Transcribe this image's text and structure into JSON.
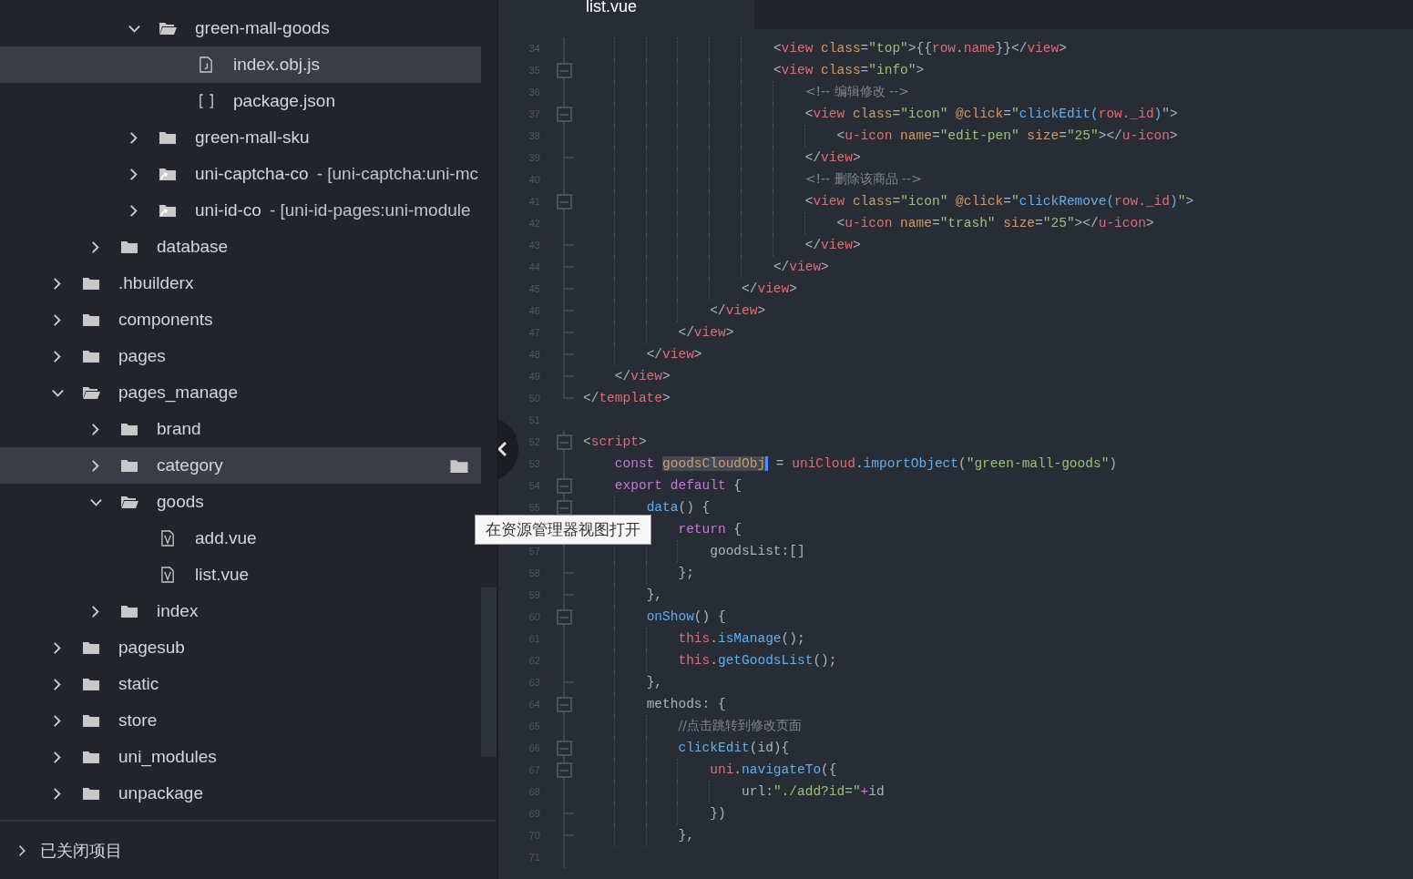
{
  "sidebar": {
    "tree": [
      {
        "children": [
          {
            "children": [
              {
                "label": "green-mall-goods",
                "kind": "folder",
                "expanded": true,
                "selected": false,
                "hovered": false,
                "children": [
                  {
                    "label": "index.obj.js",
                    "kind": "js",
                    "selected": true,
                    "hovered": false
                  },
                  {
                    "label": "package.json",
                    "kind": "json",
                    "selected": false,
                    "hovered": false
                  }
                ]
              },
              {
                "label": "green-mall-sku",
                "kind": "folder",
                "expanded": false,
                "selected": false,
                "hovered": false
              },
              {
                "label": "uni-captcha-co",
                "suffix": "- [uni-captcha:uni-mc",
                "kind": "linked-folder",
                "expanded": false,
                "selected": false,
                "hovered": false
              },
              {
                "label": "uni-id-co",
                "suffix": "- [uni-id-pages:uni-module",
                "kind": "linked-folder",
                "expanded": false,
                "selected": false,
                "hovered": false
              }
            ]
          },
          {
            "label": "database",
            "kind": "folder",
            "expanded": false,
            "selected": false,
            "hovered": false
          }
        ]
      },
      {
        "label": ".hbuilderx",
        "kind": "folder",
        "expanded": false,
        "selected": false,
        "hovered": false
      },
      {
        "label": "components",
        "kind": "folder",
        "expanded": false,
        "selected": false,
        "hovered": false
      },
      {
        "label": "pages",
        "kind": "folder",
        "expanded": false,
        "selected": false,
        "hovered": false
      },
      {
        "label": "pages_manage",
        "kind": "folder",
        "expanded": true,
        "selected": false,
        "hovered": false,
        "children": [
          {
            "label": "brand",
            "kind": "folder",
            "expanded": false,
            "selected": false,
            "hovered": false
          },
          {
            "label": "category",
            "kind": "folder",
            "expanded": false,
            "selected": true,
            "hovered": true
          },
          {
            "label": "goods",
            "kind": "folder",
            "expanded": true,
            "selected": false,
            "hovered": false,
            "children": [
              {
                "label": "add.vue",
                "kind": "vue",
                "selected": false,
                "hovered": false
              },
              {
                "label": "list.vue",
                "kind": "vue",
                "selected": false,
                "hovered": false
              }
            ]
          },
          {
            "label": "index",
            "kind": "folder",
            "expanded": false,
            "selected": false,
            "hovered": false
          }
        ]
      },
      {
        "label": "pagesub",
        "kind": "folder",
        "expanded": false,
        "selected": false,
        "hovered": false
      },
      {
        "label": "static",
        "kind": "folder",
        "expanded": false,
        "selected": false,
        "hovered": false
      },
      {
        "label": "store",
        "kind": "folder",
        "expanded": false,
        "selected": false,
        "hovered": false
      },
      {
        "label": "uni_modules",
        "kind": "folder",
        "expanded": false,
        "selected": false,
        "hovered": false
      },
      {
        "label": "unpackage",
        "kind": "folder",
        "expanded": false,
        "selected": false,
        "hovered": false
      }
    ],
    "closed_projects": {
      "label": "已关闭项目",
      "expanded": false
    }
  },
  "tooltip": "在资源管理器视图打开",
  "editor": {
    "tab": {
      "label": "list.vue",
      "selected": true
    },
    "lines": [
      {
        "n": "34",
        "kind": "line",
        "tokens": [
          {
            "kind": "punct",
            "text": "                        <"
          },
          {
            "kind": "tag",
            "text": "view"
          },
          {
            "kind": "attr",
            "text": " class"
          },
          {
            "kind": "punct",
            "text": "="
          },
          {
            "kind": "string",
            "text": "\"top\""
          },
          {
            "kind": "punct",
            "text": ">{{"
          },
          {
            "kind": "variable",
            "text": "row"
          },
          {
            "kind": "punct",
            "text": "."
          },
          {
            "kind": "variable",
            "text": "name"
          },
          {
            "kind": "punct",
            "text": "}}</"
          },
          {
            "kind": "tag",
            "text": "view"
          },
          {
            "kind": "punct",
            "text": ">"
          }
        ]
      },
      {
        "n": "35",
        "kind": "fold",
        "tokens": [
          {
            "kind": "punct",
            "text": "                        <"
          },
          {
            "kind": "tag",
            "text": "view"
          },
          {
            "kind": "attr",
            "text": " class"
          },
          {
            "kind": "punct",
            "text": "="
          },
          {
            "kind": "string",
            "text": "\"info\""
          },
          {
            "kind": "punct",
            "text": ">"
          }
        ]
      },
      {
        "n": "36",
        "kind": "line",
        "tokens": [
          {
            "kind": "comment",
            "text": "                            <!-- 编辑修改 -->"
          }
        ]
      },
      {
        "n": "37",
        "kind": "fold",
        "tokens": [
          {
            "kind": "punct",
            "text": "                            <"
          },
          {
            "kind": "tag",
            "text": "view"
          },
          {
            "kind": "attr",
            "text": " class"
          },
          {
            "kind": "punct",
            "text": "="
          },
          {
            "kind": "string",
            "text": "\"icon\""
          },
          {
            "kind": "attr",
            "text": " @click"
          },
          {
            "kind": "punct",
            "text": "="
          },
          {
            "kind": "string",
            "text": "\""
          },
          {
            "kind": "function",
            "text": "clickEdit("
          },
          {
            "kind": "variable",
            "text": "row._id"
          },
          {
            "kind": "function",
            "text": ")"
          },
          {
            "kind": "string",
            "text": "\""
          },
          {
            "kind": "punct",
            "text": ">"
          }
        ]
      },
      {
        "n": "38",
        "kind": "line",
        "tokens": [
          {
            "kind": "punct",
            "text": "                                <"
          },
          {
            "kind": "tag",
            "text": "u-icon"
          },
          {
            "kind": "attr",
            "text": " name"
          },
          {
            "kind": "punct",
            "text": "="
          },
          {
            "kind": "string",
            "text": "\"edit-pen\""
          },
          {
            "kind": "attr",
            "text": " size"
          },
          {
            "kind": "punct",
            "text": "="
          },
          {
            "kind": "string",
            "text": "\"25\""
          },
          {
            "kind": "punct",
            "text": "></"
          },
          {
            "kind": "tag",
            "text": "u-icon"
          },
          {
            "kind": "punct",
            "text": ">"
          }
        ]
      },
      {
        "n": "39",
        "kind": "end",
        "tokens": [
          {
            "kind": "punct",
            "text": "                            </"
          },
          {
            "kind": "tag",
            "text": "view"
          },
          {
            "kind": "punct",
            "text": ">"
          }
        ]
      },
      {
        "n": "40",
        "kind": "line",
        "tokens": [
          {
            "kind": "comment",
            "text": "                            <!-- 删除该商品 -->"
          }
        ]
      },
      {
        "n": "41",
        "kind": "fold",
        "tokens": [
          {
            "kind": "punct",
            "text": "                            <"
          },
          {
            "kind": "tag",
            "text": "view"
          },
          {
            "kind": "attr",
            "text": " class"
          },
          {
            "kind": "punct",
            "text": "="
          },
          {
            "kind": "string",
            "text": "\"icon\""
          },
          {
            "kind": "attr",
            "text": " @click"
          },
          {
            "kind": "punct",
            "text": "="
          },
          {
            "kind": "string",
            "text": "\""
          },
          {
            "kind": "function",
            "text": "clickRemove("
          },
          {
            "kind": "variable",
            "text": "row._id"
          },
          {
            "kind": "function",
            "text": ")"
          },
          {
            "kind": "string",
            "text": "\""
          },
          {
            "kind": "punct",
            "text": ">"
          }
        ]
      },
      {
        "n": "42",
        "kind": "line",
        "tokens": [
          {
            "kind": "punct",
            "text": "                                <"
          },
          {
            "kind": "tag",
            "text": "u-icon"
          },
          {
            "kind": "attr",
            "text": " name"
          },
          {
            "kind": "punct",
            "text": "="
          },
          {
            "kind": "string",
            "text": "\"trash\""
          },
          {
            "kind": "attr",
            "text": " size"
          },
          {
            "kind": "punct",
            "text": "="
          },
          {
            "kind": "string",
            "text": "\"25\""
          },
          {
            "kind": "punct",
            "text": "></"
          },
          {
            "kind": "tag",
            "text": "u-icon"
          },
          {
            "kind": "punct",
            "text": ">"
          }
        ]
      },
      {
        "n": "43",
        "kind": "end",
        "tokens": [
          {
            "kind": "punct",
            "text": "                            </"
          },
          {
            "kind": "tag",
            "text": "view"
          },
          {
            "kind": "punct",
            "text": ">"
          }
        ]
      },
      {
        "n": "44",
        "kind": "end",
        "tokens": [
          {
            "kind": "punct",
            "text": "                        </"
          },
          {
            "kind": "tag",
            "text": "view"
          },
          {
            "kind": "punct",
            "text": ">"
          }
        ]
      },
      {
        "n": "45",
        "kind": "end",
        "tokens": [
          {
            "kind": "punct",
            "text": "                    </"
          },
          {
            "kind": "tag",
            "text": "view"
          },
          {
            "kind": "punct",
            "text": ">"
          }
        ]
      },
      {
        "n": "46",
        "kind": "end",
        "tokens": [
          {
            "kind": "punct",
            "text": "                </"
          },
          {
            "kind": "tag",
            "text": "view"
          },
          {
            "kind": "punct",
            "text": ">"
          }
        ]
      },
      {
        "n": "47",
        "kind": "end",
        "tokens": [
          {
            "kind": "punct",
            "text": "            </"
          },
          {
            "kind": "tag",
            "text": "view"
          },
          {
            "kind": "punct",
            "text": ">"
          }
        ]
      },
      {
        "n": "48",
        "kind": "end",
        "tokens": [
          {
            "kind": "punct",
            "text": "        </"
          },
          {
            "kind": "tag",
            "text": "view"
          },
          {
            "kind": "punct",
            "text": ">"
          }
        ]
      },
      {
        "n": "49",
        "kind": "end",
        "tokens": [
          {
            "kind": "punct",
            "text": "    </"
          },
          {
            "kind": "tag",
            "text": "view"
          },
          {
            "kind": "punct",
            "text": ">"
          }
        ]
      },
      {
        "n": "50",
        "kind": "last",
        "tokens": [
          {
            "kind": "punct",
            "text": "</"
          },
          {
            "kind": "tag",
            "text": "template"
          },
          {
            "kind": "punct",
            "text": ">"
          }
        ]
      },
      {
        "n": "51",
        "kind": "blank"
      },
      {
        "n": "52",
        "kind": "fold",
        "tokens": [
          {
            "kind": "punct",
            "text": "<"
          },
          {
            "kind": "tag",
            "text": "script"
          },
          {
            "kind": "punct",
            "text": ">"
          }
        ]
      },
      {
        "n": "53",
        "kind": "line",
        "tokens": [
          {
            "kind": "keyword",
            "text": "    const "
          },
          {
            "kind": "match",
            "text": "goodsCloudObj"
          },
          {
            "kind": "punct",
            "text": " = "
          },
          {
            "kind": "variable",
            "text": "uniCloud"
          },
          {
            "kind": "punct",
            "text": "."
          },
          {
            "kind": "function",
            "text": "importObject"
          },
          {
            "kind": "punct",
            "text": "("
          },
          {
            "kind": "string",
            "text": "\"green-mall-goods\""
          },
          {
            "kind": "punct",
            "text": ")"
          }
        ]
      },
      {
        "n": "54",
        "kind": "fold",
        "tokens": [
          {
            "kind": "keyword",
            "text": "    export default"
          },
          {
            "kind": "punct",
            "text": " {"
          }
        ]
      },
      {
        "n": "55",
        "kind": "fold",
        "tokens": [
          {
            "kind": "function",
            "text": "        data"
          },
          {
            "kind": "punct",
            "text": "() {"
          }
        ]
      },
      {
        "kind": "line",
        "tokens": [
          {
            "kind": "keyword",
            "text": "            return"
          },
          {
            "kind": "punct",
            "text": " {"
          }
        ]
      },
      {
        "n": "57",
        "kind": "line",
        "tokens": [
          {
            "kind": "plain",
            "text": "                goodsList:[]"
          }
        ]
      },
      {
        "n": "58",
        "kind": "end",
        "tokens": [
          {
            "kind": "punct",
            "text": "            };"
          }
        ]
      },
      {
        "n": "59",
        "kind": "end",
        "tokens": [
          {
            "kind": "punct",
            "text": "        },"
          }
        ]
      },
      {
        "n": "60",
        "kind": "fold",
        "tokens": [
          {
            "kind": "function",
            "text": "        onShow"
          },
          {
            "kind": "punct",
            "text": "() {"
          }
        ]
      },
      {
        "n": "61",
        "kind": "line",
        "tokens": [
          {
            "kind": "variable",
            "text": "            this"
          },
          {
            "kind": "punct",
            "text": "."
          },
          {
            "kind": "function",
            "text": "isManage"
          },
          {
            "kind": "punct",
            "text": "();"
          }
        ]
      },
      {
        "n": "62",
        "kind": "line",
        "tokens": [
          {
            "kind": "variable",
            "text": "            this"
          },
          {
            "kind": "punct",
            "text": "."
          },
          {
            "kind": "function",
            "text": "getGoodsList"
          },
          {
            "kind": "punct",
            "text": "();"
          }
        ]
      },
      {
        "n": "63",
        "kind": "end",
        "tokens": [
          {
            "kind": "punct",
            "text": "        },"
          }
        ]
      },
      {
        "n": "64",
        "kind": "fold",
        "tokens": [
          {
            "kind": "plain",
            "text": "        methods"
          },
          {
            "kind": "punct",
            "text": ": {"
          }
        ]
      },
      {
        "n": "65",
        "kind": "line",
        "tokens": [
          {
            "kind": "comment",
            "text": "            //点击跳转到修改页面"
          }
        ]
      },
      {
        "n": "66",
        "kind": "fold",
        "tokens": [
          {
            "kind": "function",
            "text": "            clickEdit"
          },
          {
            "kind": "punct",
            "text": "(id){"
          }
        ]
      },
      {
        "n": "67",
        "kind": "fold",
        "tokens": [
          {
            "kind": "variable",
            "text": "                uni"
          },
          {
            "kind": "punct",
            "text": "."
          },
          {
            "kind": "function",
            "text": "navigateTo"
          },
          {
            "kind": "punct",
            "text": "({"
          }
        ]
      },
      {
        "n": "68",
        "kind": "line",
        "tokens": [
          {
            "kind": "plain",
            "text": "                    url"
          },
          {
            "kind": "punct",
            "text": ":"
          },
          {
            "kind": "string",
            "text": "\"./add?id=\""
          },
          {
            "kind": "keyword",
            "text": "+"
          },
          {
            "kind": "plain",
            "text": "id"
          }
        ]
      },
      {
        "n": "69",
        "kind": "end",
        "tokens": [
          {
            "kind": "punct",
            "text": "                })"
          }
        ]
      },
      {
        "n": "70",
        "kind": "end",
        "tokens": [
          {
            "kind": "punct",
            "text": "            },"
          }
        ]
      },
      {
        "n": "71",
        "kind": "line"
      }
    ]
  }
}
